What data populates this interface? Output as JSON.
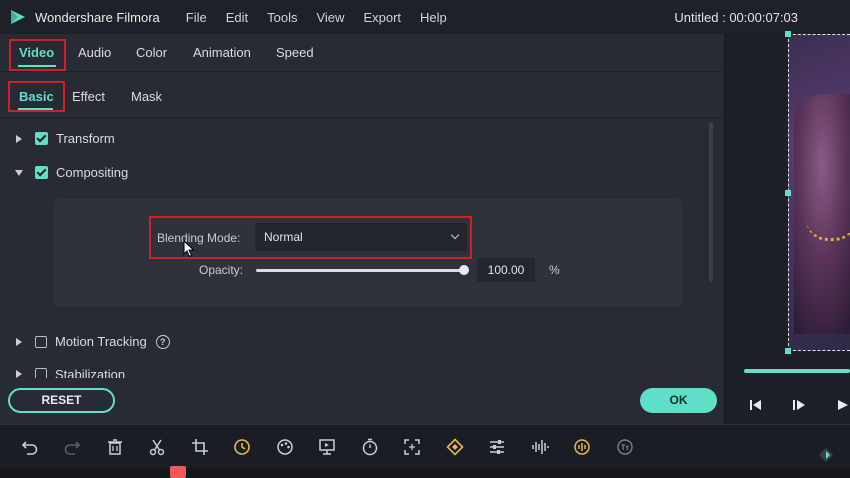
{
  "app": {
    "name": "Wondershare Filmora",
    "project_title": "Untitled : 00:00:07:03"
  },
  "menu": [
    "File",
    "Edit",
    "Tools",
    "View",
    "Export",
    "Help"
  ],
  "tabs_primary": [
    "Video",
    "Audio",
    "Color",
    "Animation",
    "Speed"
  ],
  "tabs_secondary": [
    "Basic",
    "Effect",
    "Mask"
  ],
  "sections": {
    "transform": "Transform",
    "compositing": "Compositing",
    "motion_tracking": "Motion Tracking",
    "stabilization": "Stabilization"
  },
  "compositing": {
    "blending_label": "Blending Mode:",
    "blending_value": "Normal",
    "opacity_label": "Opacity:",
    "opacity_value": "100.00",
    "opacity_unit": "%",
    "opacity_fraction": 1.0
  },
  "buttons": {
    "reset": "RESET",
    "ok": "OK"
  },
  "help_glyph": "?",
  "colors": {
    "accent": "#5fe0c6",
    "highlight_box": "#d11f2a",
    "panel_bg": "#272b33"
  },
  "toolbar_icons": [
    "undo-icon",
    "redo-icon",
    "delete-icon",
    "cut-icon",
    "crop-icon",
    "speed-icon",
    "color-icon",
    "freeze-icon",
    "timer-icon",
    "fullscreen-icon",
    "keyframe-icon",
    "adjust-icon",
    "audio-icon",
    "voice-icon",
    "speech-to-text-icon"
  ]
}
